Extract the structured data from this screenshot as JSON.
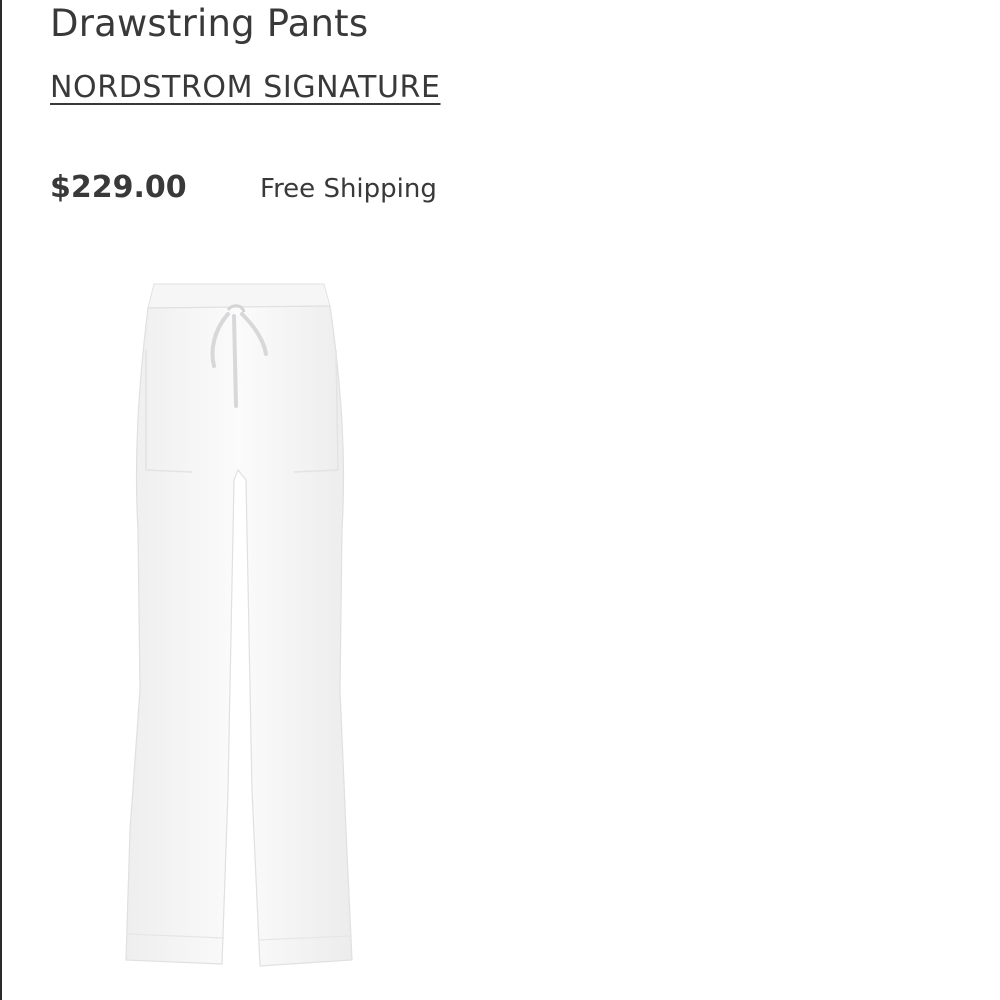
{
  "product": {
    "title": "Drawstring Pants",
    "brand": "NORDSTROM SIGNATURE",
    "price": "$229.00",
    "shipping": "Free Shipping",
    "image_color": "#ffffff"
  }
}
